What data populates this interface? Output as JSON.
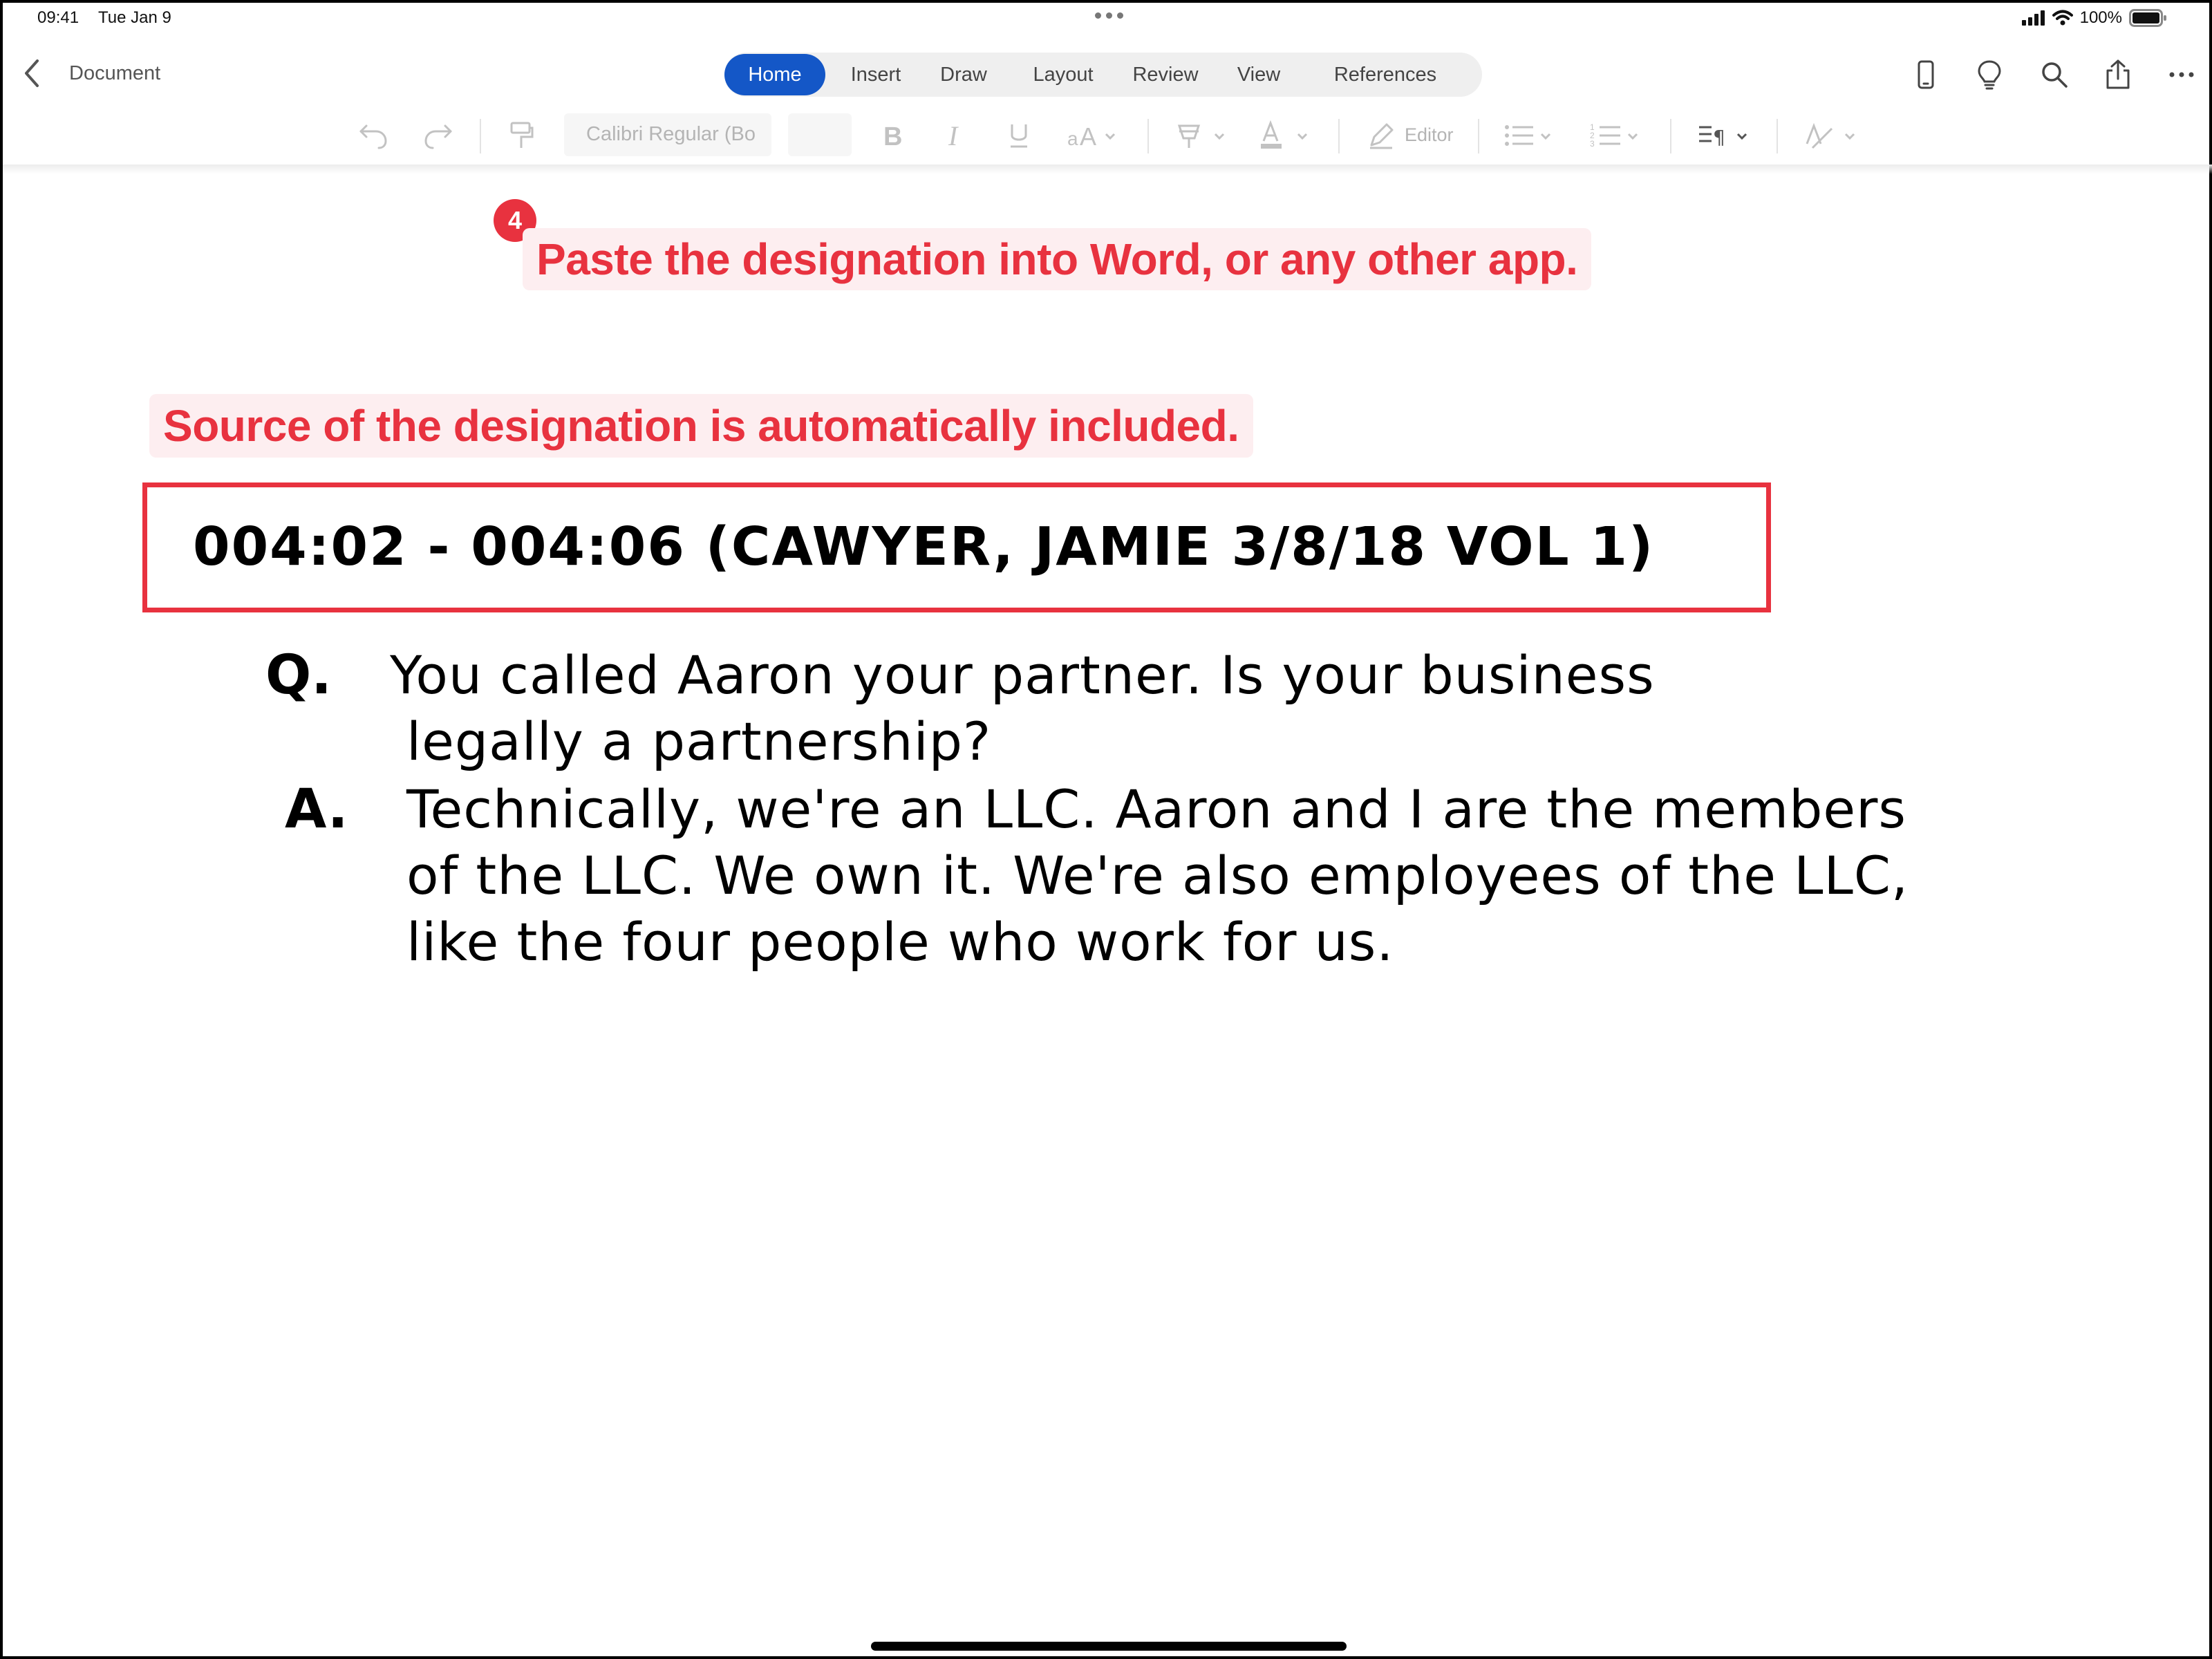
{
  "status_bar": {
    "time": "09:41",
    "date": "Tue Jan 9",
    "battery": "100%"
  },
  "nav": {
    "back_icon": "chevron-left-icon",
    "document_title": "Document",
    "tabs": [
      {
        "label": "Home",
        "active": true
      },
      {
        "label": "Insert",
        "active": false
      },
      {
        "label": "Draw",
        "active": false
      },
      {
        "label": "Layout",
        "active": false
      },
      {
        "label": "Review",
        "active": false
      },
      {
        "label": "View",
        "active": false
      },
      {
        "label": "References",
        "active": false
      }
    ],
    "right_icons": [
      "phone-view-icon",
      "lightbulb-icon",
      "search-icon",
      "share-icon",
      "more-icon"
    ]
  },
  "toolbar": {
    "font_name": "Calibri Regular (Bo",
    "font_size": "",
    "editor_label": "Editor",
    "icons": [
      "undo-icon",
      "redo-icon",
      "format-painter-icon",
      "bold-icon",
      "italic-icon",
      "underline-icon",
      "font-size-icon",
      "highlight-icon",
      "font-color-icon",
      "editor-icon",
      "bullets-icon",
      "numbering-icon",
      "paragraph-icon",
      "styles-icon"
    ]
  },
  "annotations": {
    "step_number": "4",
    "paste_instruction": "Paste the designation into Word, or any other app.",
    "source_note": "Source of the designation is automatically included."
  },
  "document": {
    "designation": "004:02 - 004:06 (CAWYER, JAMIE 3/8/18 VOL 1)",
    "q_label": "Q.",
    "q_lines": [
      "You called Aaron your partner.  Is your business",
      "legally a partnership?"
    ],
    "a_label": "A.",
    "a_lines": [
      "Technically, we're an LLC.  Aaron and I are the members",
      "of the LLC.  We own it.  We're also employees of the LLC,",
      "like the four people who work for us."
    ]
  },
  "colors": {
    "accent_red": "#e8323f",
    "callout_bg": "#fdeef0",
    "tab_active": "#1457c7"
  }
}
